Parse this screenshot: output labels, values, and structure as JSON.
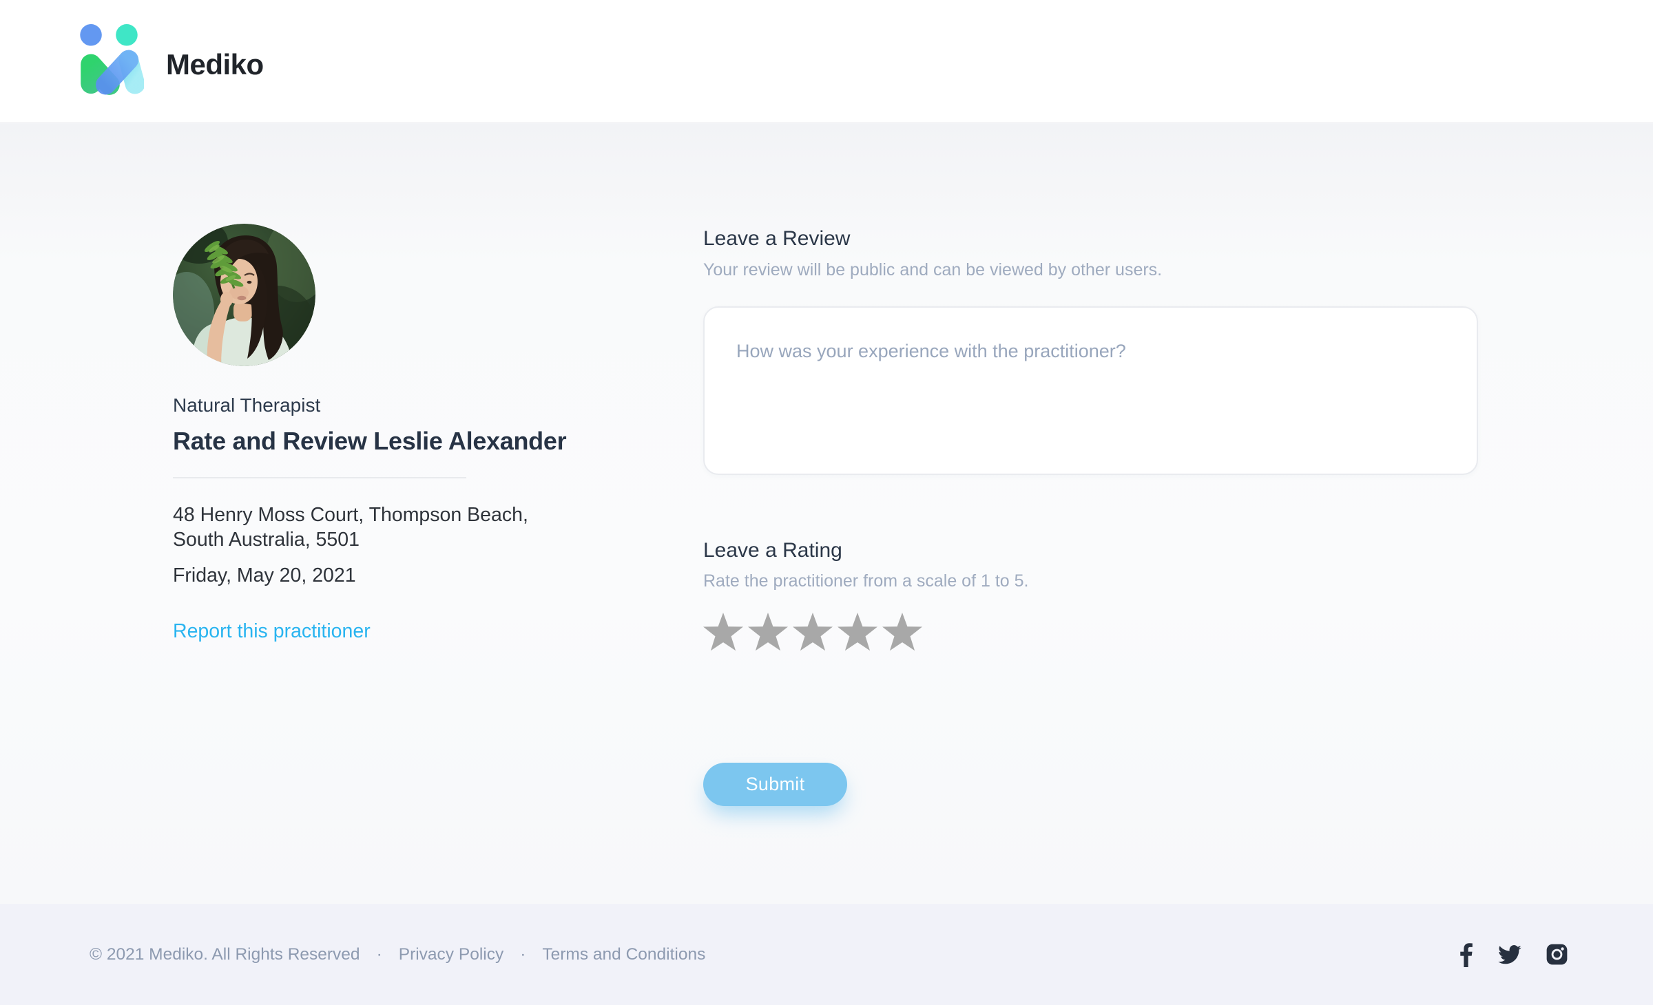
{
  "header": {
    "brand": "Mediko"
  },
  "practitioner": {
    "role": "Natural Therapist",
    "title": "Rate and Review Leslie Alexander",
    "address": "48 Henry Moss Court, Thompson Beach, South Australia, 5501",
    "date": "Friday, May 20, 2021",
    "report_link": "Report this practitioner"
  },
  "review": {
    "heading": "Leave a Review",
    "subheading": "Your review will be public and can be viewed by other users.",
    "placeholder": "How was your experience with the practitioner?",
    "value": ""
  },
  "rating": {
    "heading": "Leave a Rating",
    "subheading": "Rate the practitioner from a scale of 1 to 5.",
    "stars_total": 5,
    "stars_selected": 0
  },
  "submit_label": "Submit",
  "footer": {
    "copyright": "© 2021 Mediko. All Rights Reserved",
    "separator": "·",
    "links": [
      "Privacy Policy",
      "Terms and Conditions"
    ],
    "social_icons": [
      "facebook-icon",
      "twitter-icon",
      "instagram-icon"
    ]
  },
  "colors": {
    "accent_link": "#29b4f0",
    "submit_blue": "#7cc6ef",
    "star_gray": "#a8a8a8",
    "heading_dark": "#2b3748",
    "muted_text": "#9fabbf",
    "footer_text": "#8d9ab0",
    "footer_bg": "#f1f2f9",
    "logo_dot_blue": "#6398f1",
    "logo_dot_mint": "#3fe6c6",
    "logo_green": "#32d673",
    "logo_cyan": "#84e0f0",
    "social_dark": "#27303f"
  }
}
